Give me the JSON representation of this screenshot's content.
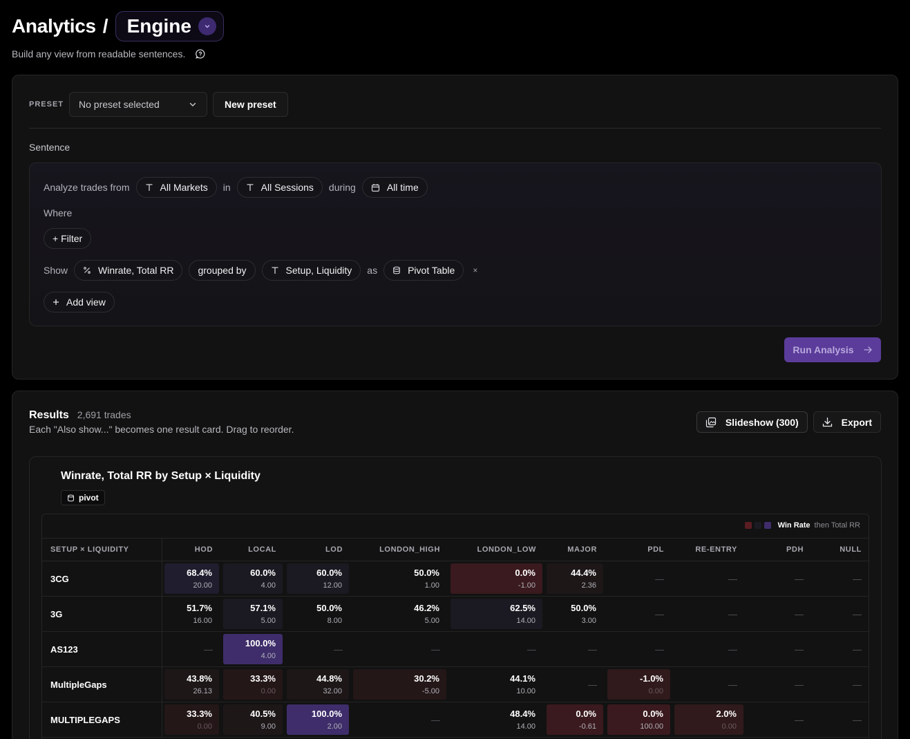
{
  "header": {
    "section": "Analytics",
    "separator": "/",
    "page": "Engine",
    "subtitle": "Build any view from readable sentences."
  },
  "builder": {
    "preset_label": "PRESET",
    "preset_value": "No preset selected",
    "new_preset_label": "New preset",
    "sentence_label": "Sentence",
    "row1": {
      "prefix": "Analyze trades from",
      "markets": "All Markets",
      "in": "in",
      "sessions": "All Sessions",
      "during": "during",
      "time": "All time"
    },
    "where_label": "Where",
    "filter_label": "+ Filter",
    "show": {
      "prefix": "Show",
      "metrics": "Winrate, Total RR",
      "grouped_by": "grouped by",
      "groups": "Setup, Liquidity",
      "as": "as",
      "view": "Pivot Table",
      "remove": "×"
    },
    "add_view_label": "Add view",
    "run_label": "Run Analysis"
  },
  "results": {
    "title": "Results",
    "count": "2,691 trades",
    "subtitle": "Each \"Also show...\" becomes one result card. Drag to reorder.",
    "slideshow_label": "Slideshow (300)",
    "export_label": "Export"
  },
  "card": {
    "title": "Winrate, Total RR by Setup × Liquidity",
    "badge": "pivot",
    "legend": {
      "primary": "Win Rate",
      "secondary": "then Total RR",
      "colors": [
        "#5a1d22",
        "#1c1b24",
        "#3e2d6a"
      ]
    },
    "columns": [
      "SETUP × LIQUIDITY",
      "HOD",
      "LOCAL",
      "LOD",
      "LONDON_HIGH",
      "LONDON_LOW",
      "MAJOR",
      "PDL",
      "RE-ENTRY",
      "PDH",
      "NULL"
    ],
    "rows": [
      {
        "label": "3CG",
        "cells": [
          {
            "wr": "68.4%",
            "rr": "20.00",
            "tone": "purple-low"
          },
          {
            "wr": "60.0%",
            "rr": "4.00",
            "tone": "neutral"
          },
          {
            "wr": "60.0%",
            "rr": "12.00",
            "tone": "neutral"
          },
          {
            "wr": "50.0%",
            "rr": "1.00",
            "tone": "none"
          },
          {
            "wr": "0.0%",
            "rr": "-1.00",
            "tone": "red-high"
          },
          {
            "wr": "44.4%",
            "rr": "2.36",
            "tone": "red-faint"
          },
          null,
          null,
          null,
          null
        ]
      },
      {
        "label": "3G",
        "cells": [
          {
            "wr": "51.7%",
            "rr": "16.00",
            "tone": "none"
          },
          {
            "wr": "57.1%",
            "rr": "5.00",
            "tone": "neutral"
          },
          {
            "wr": "50.0%",
            "rr": "8.00",
            "tone": "none"
          },
          {
            "wr": "46.2%",
            "rr": "5.00",
            "tone": "none"
          },
          {
            "wr": "62.5%",
            "rr": "14.00",
            "tone": "neutral"
          },
          {
            "wr": "50.0%",
            "rr": "3.00",
            "tone": "none"
          },
          null,
          null,
          null,
          null
        ]
      },
      {
        "label": "AS123",
        "cells": [
          null,
          {
            "wr": "100.0%",
            "rr": "4.00",
            "tone": "purple-high"
          },
          null,
          null,
          null,
          null,
          null,
          null,
          null,
          null
        ]
      },
      {
        "label": "MultipleGaps",
        "cells": [
          {
            "wr": "43.8%",
            "rr": "26.13",
            "tone": "red-faint"
          },
          {
            "wr": "33.3%",
            "rr": "0.00",
            "tone": "red-low"
          },
          {
            "wr": "44.8%",
            "rr": "32.00",
            "tone": "red-faint"
          },
          {
            "wr": "30.2%",
            "rr": "-5.00",
            "tone": "red-low"
          },
          {
            "wr": "44.1%",
            "rr": "10.00",
            "tone": "none"
          },
          null,
          {
            "wr": "-1.0%",
            "rr": "0.00",
            "tone": "red-mid"
          },
          null,
          null,
          null
        ]
      },
      {
        "label": "MULTIPLEGAPS",
        "cells": [
          {
            "wr": "33.3%",
            "rr": "0.00",
            "tone": "red-low"
          },
          {
            "wr": "40.5%",
            "rr": "9.00",
            "tone": "red-faint"
          },
          {
            "wr": "100.0%",
            "rr": "2.00",
            "tone": "purple-high"
          },
          null,
          {
            "wr": "48.4%",
            "rr": "14.00",
            "tone": "none"
          },
          {
            "wr": "0.0%",
            "rr": "-0.61",
            "tone": "red-high"
          },
          {
            "wr": "0.0%",
            "rr": "100.00",
            "tone": "red-high"
          },
          {
            "wr": "2.0%",
            "rr": "0.00",
            "tone": "red-mid"
          },
          null,
          null
        ]
      }
    ],
    "empty_cell": "—"
  }
}
